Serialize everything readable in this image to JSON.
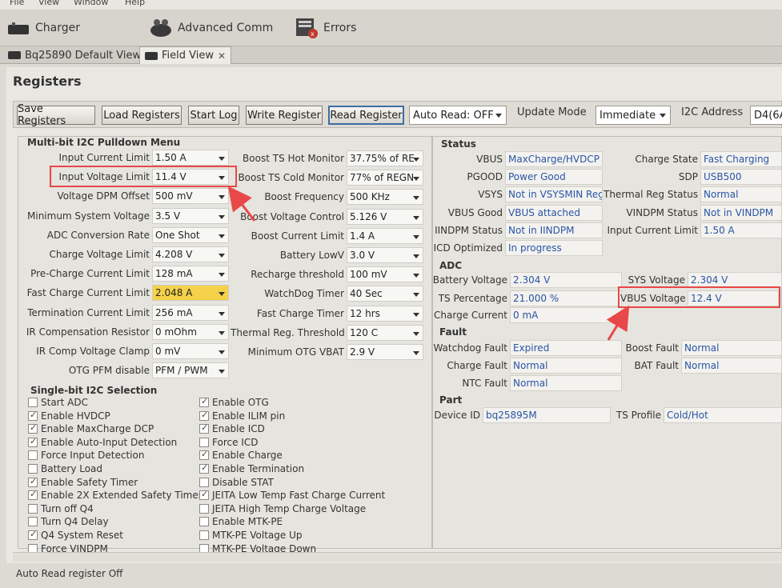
{
  "menu": {
    "file": "File",
    "view": "View",
    "window": "Window",
    "help": "Help"
  },
  "perspective_tabs": [
    {
      "label": "Charger"
    },
    {
      "label": "Advanced Comm"
    },
    {
      "label": "Errors"
    }
  ],
  "editor_tabs": [
    {
      "label": "Bq25890 Default View"
    },
    {
      "label": "Field View"
    }
  ],
  "page_title": "Registers",
  "toolbar": {
    "save": "Save Registers",
    "load": "Load Registers",
    "start_log": "Start Log",
    "write": "Write Register",
    "read": "Read Register",
    "auto_read": "Auto Read: OFF",
    "update_mode_label": "Update Mode",
    "update_mode": "Immediate",
    "i2c_label": "I2C Address",
    "i2c_value": "D4(6A"
  },
  "multi": {
    "title": "Multi-bit I2C Pulldown Menu",
    "left": [
      {
        "label": "Input Current Limit",
        "value": "1.50 A"
      },
      {
        "label": "Input Voltage Limit",
        "value": "11.4 V"
      },
      {
        "label": "Voltage DPM Offset",
        "value": "500 mV"
      },
      {
        "label": "Minimum System Voltage",
        "value": "3.5 V"
      },
      {
        "label": "ADC Conversion Rate",
        "value": "One Shot"
      },
      {
        "label": "Charge Voltage Limit",
        "value": "4.208 V"
      },
      {
        "label": "Pre-Charge Current Limit",
        "value": "128 mA"
      },
      {
        "label": "Fast Charge Current Limit",
        "value": "2.048 A"
      },
      {
        "label": "Termination Current Limit",
        "value": "256 mA"
      },
      {
        "label": "IR Compensation Resistor",
        "value": "0 mOhm"
      },
      {
        "label": "IR Comp Voltage Clamp",
        "value": "0 mV"
      },
      {
        "label": "OTG PFM disable",
        "value": "PFM / PWM"
      }
    ],
    "right": [
      {
        "label": "Boost TS Hot Monitor",
        "value": "37.75% of RE"
      },
      {
        "label": "Boost TS Cold Monitor",
        "value": "77% of REGN"
      },
      {
        "label": "Boost Frequency",
        "value": "500 KHz"
      },
      {
        "label": "Boost Voltage Control",
        "value": "5.126 V"
      },
      {
        "label": "Boost Current Limit",
        "value": "1.4 A"
      },
      {
        "label": "Battery LowV",
        "value": "3.0 V"
      },
      {
        "label": "Recharge threshold",
        "value": "100 mV"
      },
      {
        "label": "WatchDog Timer",
        "value": "40 Sec"
      },
      {
        "label": "Fast Charge Timer",
        "value": "12 hrs"
      },
      {
        "label": "Thermal Reg. Threshold",
        "value": "120 C"
      },
      {
        "label": "Minimum OTG VBAT",
        "value": "2.9 V"
      }
    ]
  },
  "single": {
    "title": "Single-bit I2C Selection",
    "left": [
      {
        "label": "Start ADC",
        "checked": false
      },
      {
        "label": "Enable HVDCP",
        "checked": true
      },
      {
        "label": "Enable MaxCharge DCP",
        "checked": true
      },
      {
        "label": "Enable Auto-Input Detection",
        "checked": true
      },
      {
        "label": "Force Input Detection",
        "checked": false
      },
      {
        "label": "Battery Load",
        "checked": false
      },
      {
        "label": "Enable Safety Timer",
        "checked": true
      },
      {
        "label": "Enable 2X Extended Safety Timer",
        "checked": true
      },
      {
        "label": "Turn off Q4",
        "checked": false
      },
      {
        "label": "Turn Q4 Delay",
        "checked": false
      },
      {
        "label": "Q4 System Reset",
        "checked": true
      },
      {
        "label": "Force VINDPM",
        "checked": false
      }
    ],
    "right": [
      {
        "label": "Enable OTG",
        "checked": true
      },
      {
        "label": "Enable ILIM pin",
        "checked": true
      },
      {
        "label": "Enable ICD",
        "checked": true
      },
      {
        "label": "Force ICD",
        "checked": false
      },
      {
        "label": "Enable Charge",
        "checked": true
      },
      {
        "label": "Enable Termination",
        "checked": true
      },
      {
        "label": "Disable STAT",
        "checked": false
      },
      {
        "label": "JEITA Low Temp Fast Charge Current",
        "checked": true
      },
      {
        "label": "JEITA High Temp Charge Voltage",
        "checked": false
      },
      {
        "label": "Enable MTK-PE",
        "checked": false
      },
      {
        "label": "MTK-PE Voltage Up",
        "checked": false
      },
      {
        "label": "MTK-PE Voltage Down",
        "checked": false
      }
    ]
  },
  "status": {
    "title": "Status",
    "left": [
      {
        "label": "VBUS",
        "value": "MaxCharge/HVDCP"
      },
      {
        "label": "PGOOD",
        "value": "Power Good"
      },
      {
        "label": "VSYS",
        "value": "Not in VSYSMIN Reg"
      },
      {
        "label": "VBUS Good",
        "value": "VBUS attached"
      },
      {
        "label": "IINDPM Status",
        "value": "Not in IINDPM"
      },
      {
        "label": "ICD Optimized",
        "value": "In progress"
      }
    ],
    "right": [
      {
        "label": "Charge State",
        "value": "Fast Charging"
      },
      {
        "label": "SDP",
        "value": "USB500"
      },
      {
        "label": "Thermal Reg Status",
        "value": "Normal"
      },
      {
        "label": "VINDPM Status",
        "value": "Not in VINDPM"
      },
      {
        "label": "Input Current Limit",
        "value": "1.50 A"
      }
    ]
  },
  "adc": {
    "title": "ADC",
    "battery_label": "Battery Voltage",
    "battery": "2.304 V",
    "ts_label": "TS Percentage",
    "ts": "21.000 %",
    "chg_label": "Charge Current",
    "chg": "0 mA",
    "sys_label": "SYS Voltage",
    "sys": "2.304 V",
    "vbus_label": "VBUS Voltage",
    "vbus": "12.4 V"
  },
  "fault": {
    "title": "Fault",
    "wd_label": "Watchdog Fault",
    "wd": "Expired",
    "chg_label": "Charge Fault",
    "chg": "Normal",
    "ntc_label": "NTC Fault",
    "ntc": "Normal",
    "boost_label": "Boost Fault",
    "boost": "Normal",
    "bat_label": "BAT Fault",
    "bat": "Normal"
  },
  "part": {
    "title": "Part",
    "id_label": "Device ID",
    "id": "bq25895M",
    "ts_label": "TS Profile",
    "ts": "Cold/Hot"
  },
  "statusbar": "Auto Read register Off",
  "colors": {
    "annotation": "#e84848",
    "highlight": "#f5d24a",
    "value_text": "#2a54a6"
  }
}
